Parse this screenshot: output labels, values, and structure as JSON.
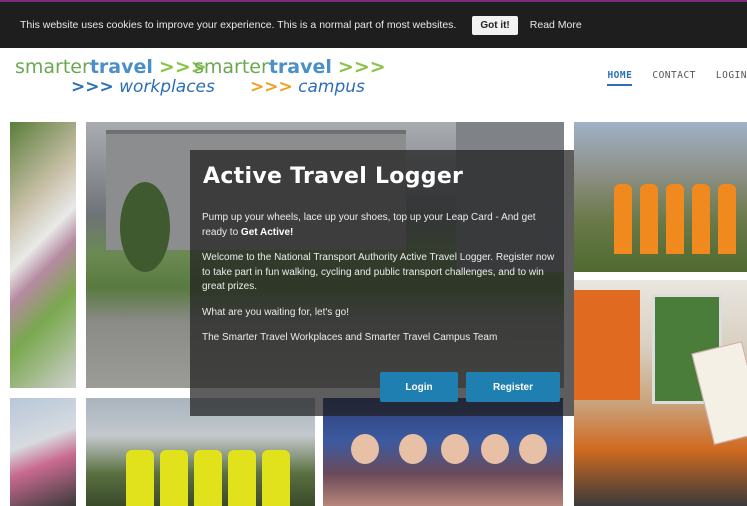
{
  "cookie_bar": {
    "message": "This website uses cookies to improve your experience. This is a normal part of most websites.",
    "accept_label": "Got it!",
    "read_more_label": "Read More"
  },
  "header": {
    "logo1": {
      "word1": "smarter",
      "word2": "travel",
      "arrows": ">>>",
      "line2_arrows": ">>>",
      "line2": "workplaces"
    },
    "logo2": {
      "word1": "smarter",
      "word2": "travel",
      "arrows": ">>>",
      "line2_arrows": ">>>",
      "line2": "campus"
    },
    "nav": [
      {
        "label": "HOME"
      },
      {
        "label": "CONTACT"
      },
      {
        "label": "LOGIN"
      }
    ]
  },
  "panel": {
    "title": "Active Travel Logger",
    "para1": "Pump up your wheels, lace up your shoes, top up your Leap Card - And get ready to",
    "para1_bold": "Get Active!",
    "para2": "Welcome to the National Transport Authority Active Travel Logger. Register now to take part in fun walking, cycling and public transport challenges, and to win great prizes.",
    "para3": "What are you waiting for, let's go!",
    "para4": "The Smarter Travel Workplaces and Smarter Travel Campus Team",
    "login_label": "Login",
    "register_label": "Register"
  },
  "colors": {
    "cookie_bar_bg": "#1e1e1e",
    "accent_blue": "#2b6fb5",
    "button_blue": "#1f7fb0",
    "logo_green": "#6aa84f",
    "logo_orange": "#f0a020"
  }
}
